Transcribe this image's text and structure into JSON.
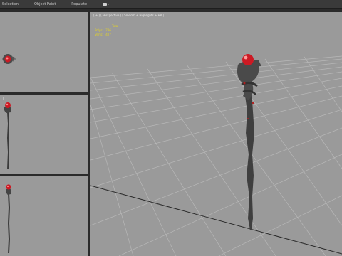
{
  "toolbar": {
    "menu": [
      "Selection",
      "Object Paint",
      "Populate"
    ]
  },
  "viewports": {
    "perspective": {
      "label": "[ + ] [ Perspective ] [ Smooth + Highlights + HR ]",
      "stats": {
        "header": "Total",
        "polys_label": "Polys:",
        "polys_value": "796",
        "verts_label": "Verts:",
        "verts_value": "427"
      }
    },
    "top": {
      "label": ""
    },
    "front": {
      "label": "["
    },
    "left": {
      "label": ""
    }
  },
  "colors": {
    "viewport_bg": "#9a9a9a",
    "grid": "#b8b8b8",
    "staff": "#3f3f3f",
    "orb": "#cc1a24",
    "stats_text": "#e2d22a"
  }
}
